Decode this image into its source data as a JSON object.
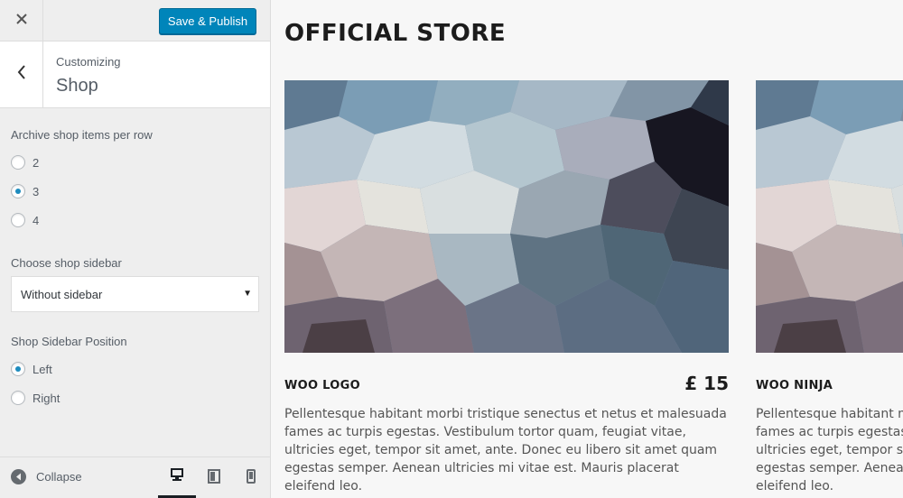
{
  "header": {
    "publish_label": "Save & Publish"
  },
  "section": {
    "breadcrumb": "Customizing",
    "title": "Shop"
  },
  "controls": {
    "items_per_row": {
      "title": "Archive shop items per row",
      "options": [
        "2",
        "3",
        "4"
      ],
      "selected": "3"
    },
    "shop_sidebar": {
      "title": "Choose shop sidebar",
      "value": "Without sidebar"
    },
    "sidebar_position": {
      "title": "Shop Sidebar Position",
      "options": [
        "Left",
        "Right"
      ],
      "selected": "Left"
    }
  },
  "footer": {
    "collapse_label": "Collapse",
    "devices": [
      "desktop-icon",
      "tablet-icon",
      "mobile-icon"
    ],
    "active_device": "desktop"
  },
  "preview": {
    "store_title": "OFFICIAL STORE",
    "products": [
      {
        "name": "WOO LOGO",
        "price": "£ 15",
        "description": "Pellentesque habitant morbi tristique senectus et netus et malesuada fames ac turpis egestas. Vestibulum tortor quam, feugiat vitae, ultricies eget, tempor sit amet, ante. Donec eu libero sit amet quam egestas semper. Aenean ultricies mi vitae est. Mauris placerat eleifend leo."
      },
      {
        "name": "WOO NINJA",
        "price": "",
        "description": "Pellentesque habitant morbi tristique senectus et netus et malesuada fames ac turpis egestas. Vestibulum tortor quam, feugiat vitae, ultricies eget, tempor sit amet, ante. Donec eu libero sit amet quam egestas semper. Aenean ultricies mi vitae est. Mauris placerat eleifend leo."
      }
    ]
  },
  "colors": {
    "accent": "#0085ba",
    "radio_checked": "#1e8cbe",
    "panel_bg": "#eeeeee",
    "preview_bg": "#f7f7f7"
  }
}
